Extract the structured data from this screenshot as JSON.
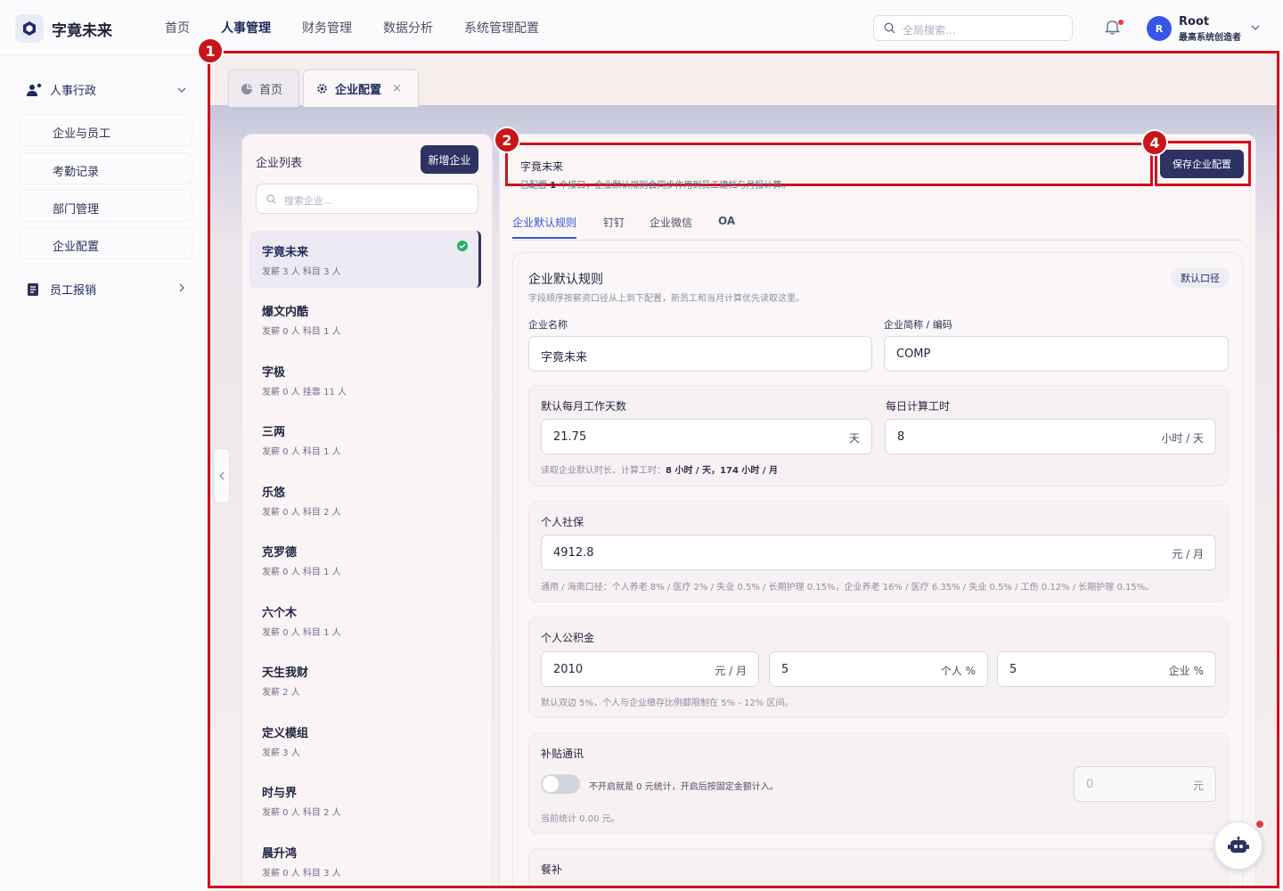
{
  "app": {
    "title": "字竟未来"
  },
  "topnav": {
    "items": [
      "首页",
      "人事管理",
      "财务管理",
      "数据分析",
      "系统管理配置"
    ],
    "active_index": 1
  },
  "search": {
    "placeholder": "全局搜索..."
  },
  "user": {
    "avatar_letter": "R",
    "name": "Root",
    "role": "最高系统创造者"
  },
  "sidebar": {
    "group1": {
      "label": "人事行政",
      "icon": "users-icon"
    },
    "items": [
      "企业与员工",
      "考勤记录",
      "部门管理",
      "企业配置"
    ],
    "active_item": 3,
    "group2": {
      "label": "员工报销",
      "icon": "receipt-icon"
    }
  },
  "annotations": [
    "1",
    "2",
    "4"
  ],
  "page_tabs": [
    {
      "label": "首页",
      "icon": "pie-chart-icon"
    },
    {
      "label": "企业配置",
      "icon": "settings-icon",
      "close": "×"
    }
  ],
  "company_list": {
    "title": "企业列表",
    "new_button": "新增企业",
    "search_placeholder": "搜索企业...",
    "items": [
      {
        "name": "字竟未来",
        "meta": "发薪 3 人  科目 3 人"
      },
      {
        "name": "爆文内酷",
        "meta": "发薪 0 人  科目 1 人"
      },
      {
        "name": "字极",
        "meta": "发薪 0 人  挂靠 11 人"
      },
      {
        "name": "三两",
        "meta": "发薪 0 人  科目 1 人"
      },
      {
        "name": "乐悠",
        "meta": "发薪 0 人  科目 2 人"
      },
      {
        "name": "克罗德",
        "meta": "发薪 0 人  科目 1 人"
      },
      {
        "name": "六个木",
        "meta": "发薪 0 人  科目 1 人"
      },
      {
        "name": "天生我财",
        "meta": "发薪 2 人"
      },
      {
        "name": "定义模组",
        "meta": "发薪 3 人"
      },
      {
        "name": "时与界",
        "meta": "发薪 0 人  科目 2 人"
      },
      {
        "name": "晨升鸿",
        "meta": "发薪 0 人  科目 3 人"
      }
    ]
  },
  "detail": {
    "company_name": "字竟未来",
    "subtitle_pre": "已配置",
    "subtitle_count": "1",
    "subtitle_post": "个接口，企业默认规则会同步作用到员工建档与月报计算。",
    "save_button": "保存企业配置",
    "tabs": [
      "企业默认规则",
      "钉钉",
      "企业微信",
      "OA"
    ],
    "active_tab": 0,
    "rules": {
      "title": "企业默认规则",
      "subtitle": "字段顺序按薪资口径从上到下配置，新员工和当月计算优先读取这里。",
      "tag": "默认口径",
      "name_label": "企业名称",
      "name_value": "字竟未来",
      "code_label": "企业简称 / 编码",
      "code_value": "COMP",
      "workdays": {
        "label": "默认每月工作天数",
        "value": "21.75",
        "unit": "天",
        "hours_label": "每日计算工时",
        "hours_value": "8",
        "hours_unit": "小时 / 天",
        "hint_pre": "读取企业默认时长、计算工时：",
        "hint_bold": "8 小时 / 天，174 小时 / 月"
      },
      "social": {
        "label": "个人社保",
        "value": "4912.8",
        "unit": "元 / 月",
        "hint": "通用 / 海南口径：个人养老 8% / 医疗 2% / 失业 0.5% / 长期护理 0.15%，企业养老 16% / 医疗 6.35% / 失业 0.5% / 工伤 0.12% / 长期护理 0.15%。"
      },
      "fund": {
        "label": "个人公积金",
        "base": "2010",
        "base_unit": "元 / 月",
        "personal": "5",
        "personal_unit": "个人 %",
        "company": "5",
        "company_unit": "企业 %",
        "hint": "默认双边 5%，个人与企业缴存比例都限制在 5% - 12% 区间。"
      },
      "comm": {
        "label": "补贴通讯",
        "toggle_on": false,
        "toggle_text": "不开启就是 0 元统计，开启后按固定金额计入。",
        "amount_placeholder": "0",
        "amount_unit": "元",
        "hint": "当前统计 0.00 元。"
      },
      "meal": {
        "label": "餐补"
      }
    }
  },
  "colors": {
    "brand": "#2c3363",
    "accent": "#3457d5",
    "annotation": "#d0111b",
    "success": "#1fb36a"
  }
}
